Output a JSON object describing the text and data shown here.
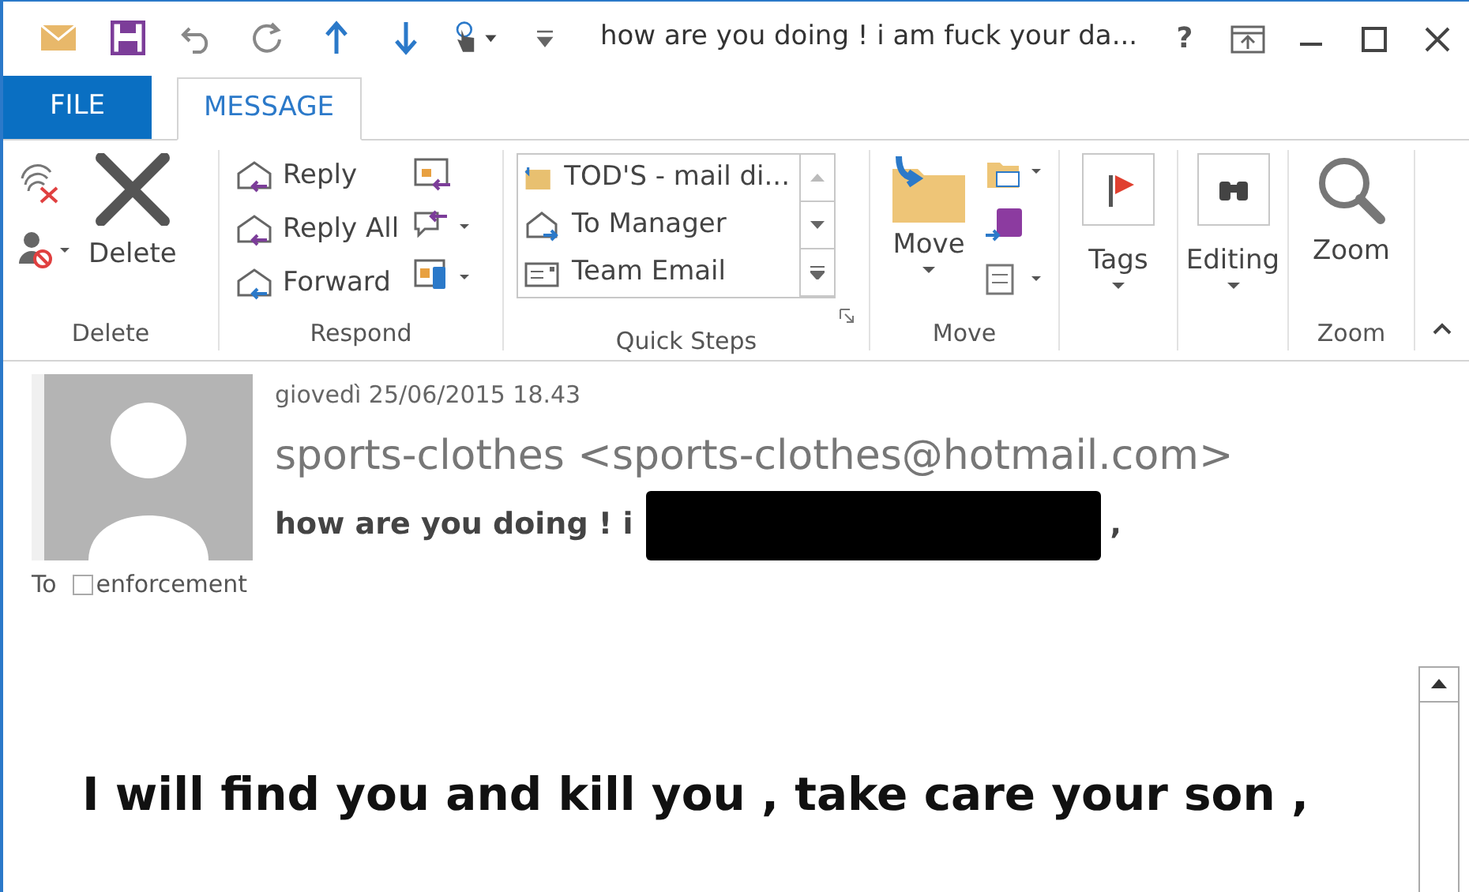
{
  "window": {
    "title": "how are you doing ! i am fuck your da...",
    "help": "?"
  },
  "tabs": [
    {
      "label": "FILE",
      "kind": "file",
      "selected": false
    },
    {
      "label": "MESSAGE",
      "kind": "tab",
      "selected": true
    }
  ],
  "ribbon": {
    "delete": {
      "label": "Delete",
      "button": "Delete"
    },
    "respond": {
      "label": "Respond",
      "buttons": [
        "Reply",
        "Reply All",
        "Forward"
      ]
    },
    "quick_steps": {
      "label": "Quick Steps",
      "items": [
        "TOD'S - mail di...",
        "To Manager",
        "Team Email"
      ]
    },
    "move": {
      "label": "Move",
      "button": "Move"
    },
    "tags": {
      "button": "Tags"
    },
    "editing": {
      "button": "Editing"
    },
    "zoom": {
      "label": "Zoom",
      "button": "Zoom"
    }
  },
  "message": {
    "date": "giovedì 25/06/2015 18.43",
    "sender": "sports-clothes <sports-clothes@hotmail.com>",
    "subject": "how are you doing ! i",
    "subject_end": ",",
    "to_label": "To",
    "recipients": [
      {
        "name": "enforcement",
        "checked": false
      }
    ]
  },
  "body": {
    "text": "I will find you and kill you , take care your son ,"
  }
}
